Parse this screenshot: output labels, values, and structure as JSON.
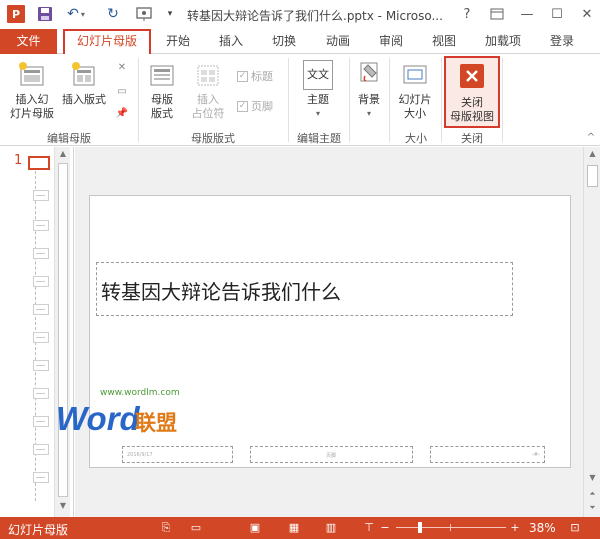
{
  "titlebar": {
    "app_logo": "P",
    "document_title": "转基因大辩论告诉了我们什么.pptx - Microso...",
    "help": "?",
    "icons": [
      "powerpoint-logo",
      "save-icon",
      "undo-icon",
      "redo-icon",
      "slideshow-icon",
      "customize-arrow-icon",
      "help-icon",
      "ribbon-display-icon",
      "minimize-icon",
      "maximize-icon",
      "close-icon"
    ]
  },
  "tabs": {
    "file": "文件",
    "slide_master": "幻灯片母版",
    "home": "开始",
    "insert": "插入",
    "transitions": "切换",
    "animations": "动画",
    "review": "审阅",
    "view": "视图",
    "addins": "加载项",
    "login": "登录"
  },
  "ribbon": {
    "groups": {
      "edit_master": "编辑母版",
      "master_layout": "母版版式",
      "edit_theme": "编辑主题",
      "size": "大小",
      "close": "关闭"
    },
    "buttons": {
      "insert_slide_master_l1": "插入幻",
      "insert_slide_master_l2": "灯片母版",
      "insert_layout": "插入版式",
      "master_layout_l1": "母版",
      "master_layout_l2": "版式",
      "insert_placeholder_l1": "插入",
      "insert_placeholder_l2": "占位符",
      "title_check": "标题",
      "footer_check": "页脚",
      "theme": "主题",
      "theme_icon_text": "文文",
      "background": "背景",
      "slide_size_l1": "幻灯片",
      "slide_size_l2": "大小",
      "close_master_l1": "关闭",
      "close_master_l2": "母版视图"
    }
  },
  "thumbnails": {
    "master_number": "1",
    "layout_count": 11
  },
  "slide": {
    "title": "转基因大辩论告诉我们什么",
    "date": "2016/9/17",
    "footer": "页脚",
    "number": "‹#›"
  },
  "watermark": {
    "url": "www.wordlm.com",
    "word": "Word",
    "lianmeng": "联盟"
  },
  "status": {
    "label": "幻灯片母版",
    "zoom": "38%",
    "zoom_level_percent": 38,
    "minus": "−",
    "plus": "+"
  },
  "colors": {
    "accent": "#d24726",
    "highlight_border": "#d63a2a"
  }
}
